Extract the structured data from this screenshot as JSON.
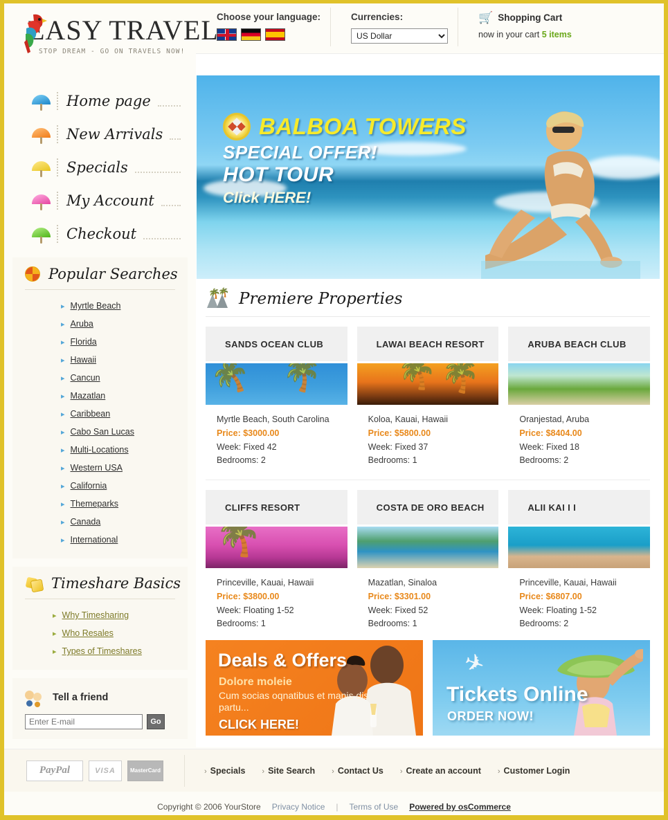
{
  "brand": {
    "name": "EASY TRAVEL",
    "tagline": "STOP DREAM - GO ON TRAVELS NOW!",
    "parrot_icon": "parrot-icon"
  },
  "topbar": {
    "language_label": "Choose your language:",
    "flags": [
      {
        "name": "flag-uk",
        "title": "English"
      },
      {
        "name": "flag-de",
        "title": "Deutsch"
      },
      {
        "name": "flag-es",
        "title": "Espanol"
      }
    ],
    "currencies_label": "Currencies:",
    "currency_selected": "US Dollar",
    "currency_options": [
      "US Dollar"
    ],
    "cart_title": "Shopping Cart",
    "cart_prefix": "now in your cart",
    "cart_count": "5 items"
  },
  "sidebar": {
    "nav": [
      {
        "label": "Home page",
        "icon": "umbrella-blue-icon"
      },
      {
        "label": "New Arrivals",
        "icon": "umbrella-orange-icon"
      },
      {
        "label": "Specials",
        "icon": "umbrella-yellow-icon"
      },
      {
        "label": "My Account",
        "icon": "umbrella-pink-icon"
      },
      {
        "label": "Checkout",
        "icon": "umbrella-green-icon"
      }
    ],
    "popular_searches": {
      "title": "Popular Searches",
      "icon": "umbrella-badge-icon",
      "items": [
        "Myrtle Beach",
        "Aruba",
        "Florida",
        "Hawaii",
        "Cancun",
        "Mazatlan",
        "Caribbean",
        "Cabo San Lucas",
        "Multi-Locations",
        "Western USA",
        "California",
        "Themeparks",
        "Canada",
        "International"
      ]
    },
    "timeshare_basics": {
      "title": "Timeshare Basics",
      "icon": "price-tag-icon",
      "items": [
        "Why Timesharing",
        "Who Resales",
        "Types of Timeshares"
      ]
    },
    "tell_a_friend": {
      "title": "Tell a friend",
      "icon": "people-icon",
      "placeholder": "Enter E-mail",
      "value": "",
      "button": "Go"
    }
  },
  "hero": {
    "icon": "compass-icon",
    "title": "BALBOA TOWERS",
    "line2": "SPECIAL OFFER!",
    "line3": "HOT TOUR",
    "cta": "Click HERE!"
  },
  "properties_section": {
    "title": "Premiere Properties",
    "icon": "palm-trees-icon",
    "labels": {
      "price": "Price:",
      "week": "Week:",
      "bedrooms": "Bedrooms:"
    },
    "items": [
      {
        "name": "SANDS OCEAN CLUB",
        "location": "Myrtle Beach, South Carolina",
        "price": "$3000.00",
        "week": "Week: Fixed 42",
        "bedrooms": "Bedrooms: 2",
        "photo": "palm-beach-blue-photo"
      },
      {
        "name": "LAWAI BEACH RESORT",
        "location": "Koloa, Kauai, Hawaii",
        "price": "$5800.00",
        "week": "Week: Fixed 37",
        "bedrooms": "Bedrooms: 1",
        "photo": "sunset-palms-photo"
      },
      {
        "name": "ARUBA BEACH CLUB",
        "location": "Oranjestad, Aruba",
        "price": "$8404.00",
        "week": "Week: Fixed 18",
        "bedrooms": "Bedrooms: 2",
        "photo": "aruba-coast-photo"
      },
      {
        "name": "CLIFFS RESORT",
        "location": "Princeville, Kauai, Hawaii",
        "price": "$3800.00",
        "week": "Week: Floating 1-52",
        "bedrooms": "Bedrooms: 1",
        "photo": "pink-sunset-palm-photo"
      },
      {
        "name": "COSTA DE ORO BEACH",
        "location": "Mazatlan, Sinaloa",
        "price": "$3301.00",
        "week": "Week: Fixed 52",
        "bedrooms": "Bedrooms: 1",
        "photo": "rocky-bay-photo"
      },
      {
        "name": "ALII KAI I I",
        "location": "Princeville, Kauai, Hawaii",
        "price": "$6807.00",
        "week": "Week: Floating 1-52",
        "bedrooms": "Bedrooms: 2",
        "photo": "turquoise-cove-photo"
      }
    ]
  },
  "promos": {
    "deals": {
      "title": "Deals & Offers",
      "subtitle": "Dolore moleie",
      "body": "Cum socias oqnatibus et manis dis partu...",
      "cta": "CLICK HERE!"
    },
    "tickets": {
      "title": "Tickets Online",
      "cta": "ORDER NOW!",
      "icon": "airplane-icon"
    }
  },
  "footer": {
    "payments": [
      {
        "label": "PayPal",
        "name": "paypal-logo"
      },
      {
        "label": "VISA",
        "name": "visa-logo"
      },
      {
        "label": "MasterCard",
        "name": "mastercard-logo"
      }
    ],
    "links": [
      "Specials",
      "Site Search",
      "Contact Us",
      "Create an account",
      "Customer Login"
    ],
    "copyright": "Copyright © 2006 YourStore",
    "privacy": "Privacy Notice",
    "separator": "|",
    "terms": "Terms of Use",
    "powered": "Powered by osCommerce"
  },
  "colors": {
    "page_border": "#e0c22a",
    "accent_price": "#e8881a",
    "cart_green": "#6aa81b",
    "link_blue": "#56a8d8",
    "link_green": "#7d7a28"
  }
}
